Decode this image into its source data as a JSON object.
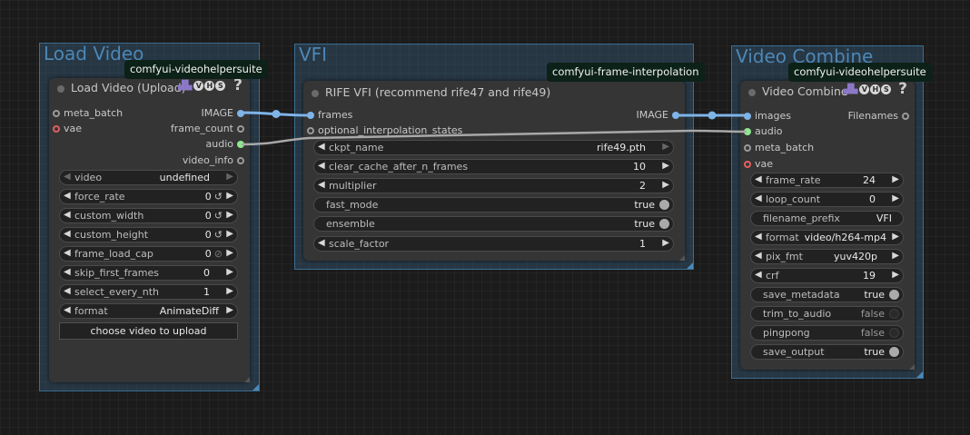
{
  "groups": {
    "load_video": {
      "title": "Load Video",
      "badge": "comfyui-videohelpersuite"
    },
    "vfi": {
      "title": "VFI",
      "badge": "comfyui-frame-interpolation"
    },
    "video_combine": {
      "title": "Video Combine",
      "badge": "comfyui-videohelpersuite"
    }
  },
  "vhs_badge": {
    "fx": "▟▙",
    "v": "V",
    "h": "H",
    "s": "S"
  },
  "help_mark": "?",
  "load_node": {
    "title": "Load Video (Upload)",
    "inputs": [
      "meta_batch",
      "vae"
    ],
    "outputs": [
      "IMAGE",
      "frame_count",
      "audio",
      "video_info"
    ],
    "widgets": [
      {
        "label": "video",
        "value": "undefined"
      },
      {
        "label": "force_rate",
        "value": "0",
        "sub": "↺"
      },
      {
        "label": "custom_width",
        "value": "0",
        "sub": "↺"
      },
      {
        "label": "custom_height",
        "value": "0",
        "sub": "↺"
      },
      {
        "label": "frame_load_cap",
        "value": "0",
        "sub": "⊘"
      },
      {
        "label": "skip_first_frames",
        "value": "0"
      },
      {
        "label": "select_every_nth",
        "value": "1"
      },
      {
        "label": "format",
        "value": "AnimateDiff"
      }
    ],
    "upload_button": "choose video to upload"
  },
  "rife_node": {
    "title": "RIFE VFI (recommend rife47 and rife49)",
    "inputs": [
      "frames",
      "optional_interpolation_states"
    ],
    "outputs": [
      "IMAGE"
    ],
    "widgets": [
      {
        "label": "ckpt_name",
        "value": "rife49.pth"
      },
      {
        "label": "clear_cache_after_n_frames",
        "value": "10"
      },
      {
        "label": "multiplier",
        "value": "2"
      },
      {
        "label": "fast_mode",
        "value": "true"
      },
      {
        "label": "ensemble",
        "value": "true"
      },
      {
        "label": "scale_factor",
        "value": "1"
      }
    ]
  },
  "combine_node": {
    "title": "Video Combine",
    "inputs": [
      "images",
      "audio",
      "meta_batch",
      "vae"
    ],
    "outputs": [
      "Filenames"
    ],
    "widgets": [
      {
        "label": "frame_rate",
        "value": "24"
      },
      {
        "label": "loop_count",
        "value": "0"
      },
      {
        "label": "filename_prefix",
        "value": "VFI"
      },
      {
        "label": "format",
        "value": "video/h264-mp4"
      },
      {
        "label": "pix_fmt",
        "value": "yuv420p"
      },
      {
        "label": "crf",
        "value": "19"
      },
      {
        "label": "save_metadata",
        "value": "true"
      },
      {
        "label": "trim_to_audio",
        "value": "false"
      },
      {
        "label": "pingpong",
        "value": "false"
      },
      {
        "label": "save_output",
        "value": "true"
      }
    ]
  },
  "colors": {
    "image_wire": "#7eb4e8",
    "audio_wire": "#a8a8a8",
    "group_border": "#3a6e92",
    "group_title": "#4c87b6",
    "badge_bg": "#0c2118"
  }
}
